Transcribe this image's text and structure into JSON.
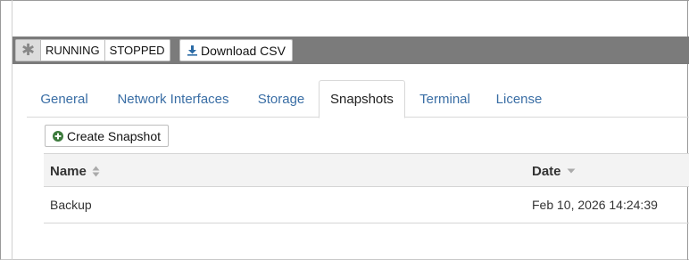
{
  "toolbar": {
    "filter_all_glyph": "✱",
    "filter_running": "RUNNING",
    "filter_stopped": "STOPPED",
    "download_csv_label": "Download CSV"
  },
  "tabs": [
    {
      "label": "General",
      "active": false
    },
    {
      "label": "Network Interfaces",
      "active": false
    },
    {
      "label": "Storage",
      "active": false
    },
    {
      "label": "Snapshots",
      "active": true
    },
    {
      "label": "Terminal",
      "active": false
    },
    {
      "label": "License",
      "active": false
    }
  ],
  "snapshots": {
    "create_label": "Create Snapshot",
    "columns": {
      "name": "Name",
      "date": "Date"
    },
    "rows": [
      {
        "name": "Backup",
        "date": "Feb 10, 2026 14:24:39"
      }
    ]
  },
  "colors": {
    "toolbar_bg": "#7b7b7b",
    "link": "#3a6ea5",
    "add_icon": "#3c7a3c",
    "download_icon": "#2a6aa5"
  }
}
